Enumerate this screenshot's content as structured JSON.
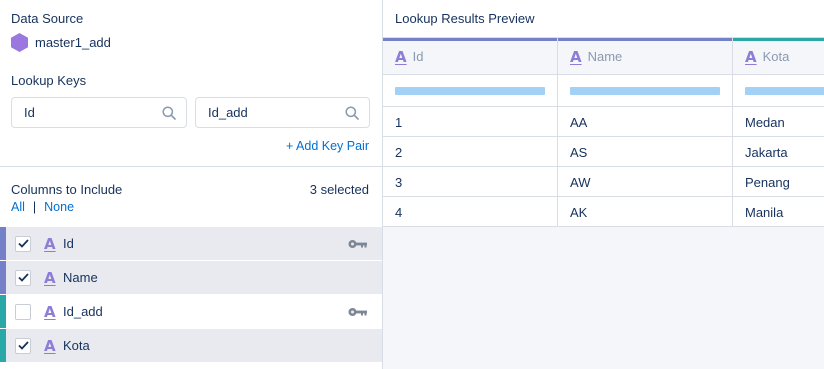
{
  "colors": {
    "accent_blue": "#0070d2",
    "purple": "#8e7dd6",
    "teal": "#2aa8a8",
    "key_bar_purple": "#7481c9",
    "filter_bar": "#a3d0f5"
  },
  "data_source": {
    "title": "Data Source",
    "name": "master1_add",
    "icon": "hexagon-icon"
  },
  "lookup_keys": {
    "title": "Lookup Keys",
    "left_value": "Id",
    "right_value": "Id_add",
    "add_label": "+ Add Key Pair"
  },
  "columns": {
    "title": "Columns to Include",
    "selected_count": "3 selected",
    "all_label": "All",
    "separator": "|",
    "none_label": "None",
    "items": [
      {
        "name": "Id",
        "checked": true,
        "is_key": true,
        "source": "master"
      },
      {
        "name": "Name",
        "checked": true,
        "is_key": false,
        "source": "master"
      },
      {
        "name": "Id_add",
        "checked": false,
        "is_key": true,
        "source": "lookup"
      },
      {
        "name": "Kota",
        "checked": true,
        "is_key": false,
        "source": "lookup"
      }
    ]
  },
  "preview": {
    "title": "Lookup Results Preview",
    "type_glyph": "A",
    "headers": [
      {
        "label": "Id",
        "source": "master"
      },
      {
        "label": "Name",
        "source": "master"
      },
      {
        "label": "Kota",
        "source": "lookup"
      }
    ],
    "rows": [
      [
        "1",
        "AA",
        "Medan"
      ],
      [
        "2",
        "AS",
        "Jakarta"
      ],
      [
        "3",
        "AW",
        "Penang"
      ],
      [
        "4",
        "AK",
        "Manila"
      ]
    ]
  }
}
